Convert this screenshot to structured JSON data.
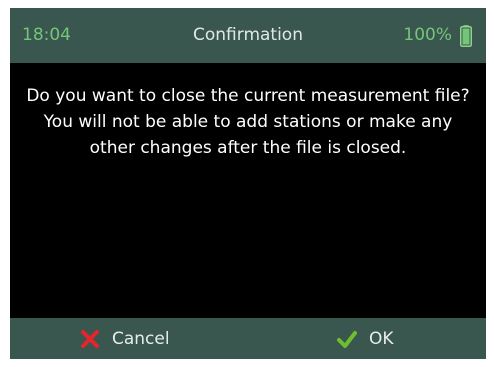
{
  "status_bar": {
    "time": "18:04",
    "title": "Confirmation",
    "battery": "100%",
    "battery_icon": "battery-full-icon",
    "accent_color": "#74c57a",
    "bar_color": "#3a574f"
  },
  "dialog": {
    "message": "Do you want to close the current measurement file? You will not be able to add stations or make any other changes after the file is closed."
  },
  "softkeys": {
    "cancel": {
      "label": "Cancel",
      "icon": "x-icon",
      "icon_color": "#e5242b"
    },
    "ok": {
      "label": "OK",
      "icon": "checkmark-icon",
      "icon_color": "#6fbe2e"
    }
  }
}
